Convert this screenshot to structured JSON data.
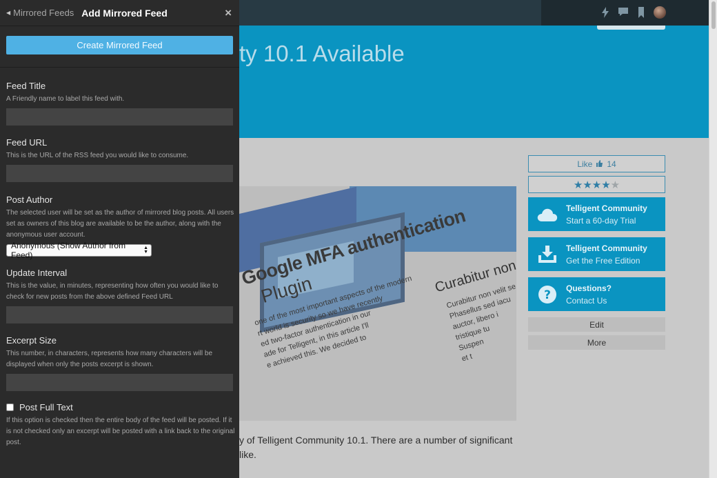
{
  "background": {
    "hero_title": "ty 10.1 Available",
    "image_headline_1": "Google MFA authentication",
    "image_headline_2": "Plugin",
    "image_side_heading": "Curabitur non v",
    "image_body_lines": [
      "one of the most important aspects of the modern",
      "rt world is security so we have recently",
      "ed two-factor authentication in our",
      "ade for Telligent, in this article I'll",
      "e achieved this. We decided to"
    ],
    "image_side_lines": [
      "Curabitur non velit se",
      "Phasellus sed iacu",
      "auctor, libero i",
      "tristique tu",
      "Suspen",
      "et t"
    ],
    "body_text_1": "y of Telligent Community 10.1. There are a number of significant",
    "body_text_2": "like.",
    "like_label": "Like",
    "like_count": "14",
    "rating": 4,
    "rating_max": 5,
    "cards": [
      {
        "title": "Telligent Community",
        "subtitle": "Start a 60-day Trial",
        "icon": "cloud-icon"
      },
      {
        "title": "Telligent Community",
        "subtitle": "Get the Free Edition",
        "icon": "download-icon"
      },
      {
        "title": "Questions?",
        "subtitle": "Contact Us",
        "icon": "question-icon"
      }
    ],
    "edit_label": "Edit",
    "more_label": "More"
  },
  "panel": {
    "back_label": "Mirrored Feeds",
    "title": "Add Mirrored Feed",
    "close_glyph": "×",
    "create_button": "Create Mirrored Feed",
    "fields": {
      "feed_title": {
        "label": "Feed Title",
        "desc": "A Friendly name to label this feed with.",
        "value": ""
      },
      "feed_url": {
        "label": "Feed URL",
        "desc": "This is the URL of the RSS feed you would like to consume.",
        "value": ""
      },
      "post_author": {
        "label": "Post Author",
        "desc": "The selected user will be set as the author of mirrored blog posts. All users set as owners of this blog are available to be the author, along with the anonymous user account.",
        "selected": "Anonymous (Show Author from Feed)"
      },
      "update_interval": {
        "label": "Update Interval",
        "desc": "This is the value, in minutes, representing how often you would like to check for new posts from the above defined Feed URL",
        "value": ""
      },
      "excerpt_size": {
        "label": "Excerpt Size",
        "desc": "This number, in characters, represents how many characters will be displayed when only the posts excerpt is shown.",
        "value": ""
      },
      "post_full_text": {
        "label": "Post Full Text",
        "desc": "If this option is checked then the entire body of the feed will be posted. If it is not checked only an excerpt will be posted with a link back to the original post.",
        "checked": false
      }
    }
  },
  "colors": {
    "panel_bg": "#2b2b2b",
    "accent_button": "#4fb1e4",
    "hero_blue": "#0a94c1"
  }
}
